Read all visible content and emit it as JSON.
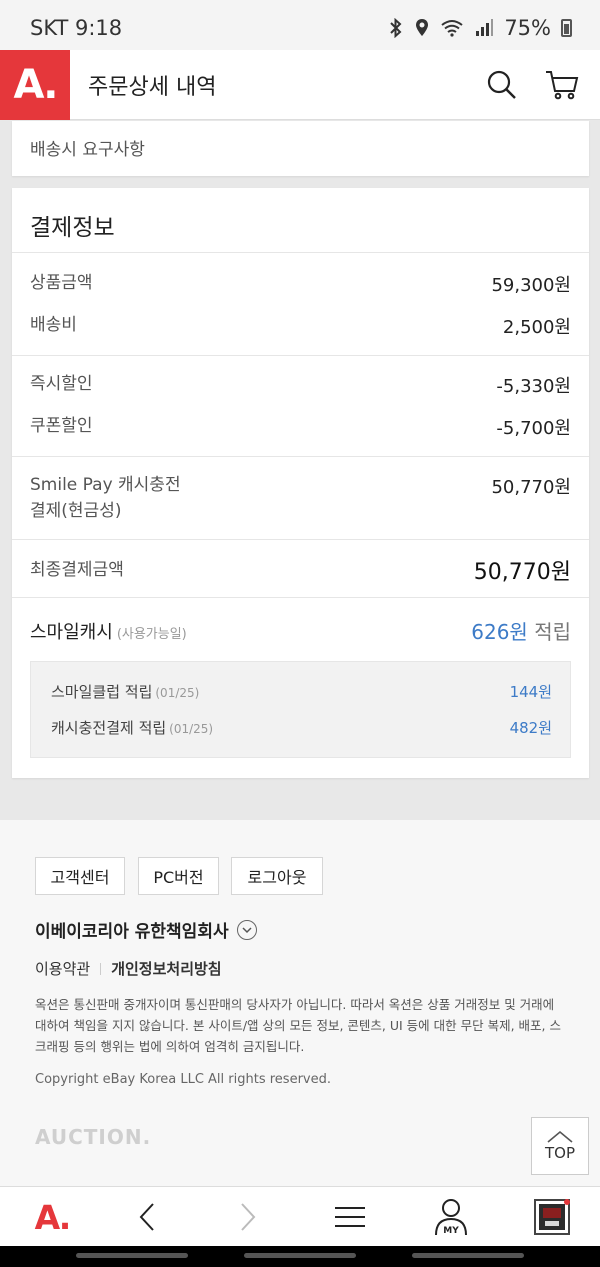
{
  "status_bar": {
    "carrier_time": "SKT 9:18",
    "battery": "75%"
  },
  "header": {
    "logo": "A.",
    "title": "주문상세 내역"
  },
  "delivery": {
    "request_label": "배송시 요구사항"
  },
  "payment": {
    "title": "결제정보",
    "rows": [
      {
        "label": "상품금액",
        "value": "59,300원"
      },
      {
        "label": "배송비",
        "value": "2,500원"
      },
      {
        "label": "즉시할인",
        "value": "-5,330원"
      },
      {
        "label": "쿠폰할인",
        "value": "-5,700원"
      },
      {
        "label_line1": "Smile Pay 캐시충전",
        "label_line2": "결제(현금성)",
        "value": "50,770원"
      }
    ],
    "final": {
      "label": "최종결제금액",
      "value": "50,770원"
    },
    "smile_cash": {
      "label": "스마일캐시",
      "sub": "(사용가능일)",
      "amount": "626원",
      "suffix": "적립"
    },
    "details": [
      {
        "label": "스마일클럽 적립",
        "date": "(01/25)",
        "value": "144원"
      },
      {
        "label": "캐시충전결제 적립",
        "date": "(01/25)",
        "value": "482원"
      }
    ]
  },
  "footer": {
    "buttons": [
      "고객센터",
      "PC버전",
      "로그아웃"
    ],
    "company": "이베이코리아 유한책임회사",
    "policy_links": [
      "이용약관",
      "개인정보처리방침"
    ],
    "notice": "옥션은 통신판매 중개자이며 통신판매의 당사자가 아닙니다. 따라서 옥션은 상품 거래정보 및 거래에 대하여 책임을 지지 않습니다. 본 사이트/앱 상의 모든 정보, 콘텐츠, UI 등에 대한 무단 복제, 배포, 스크래핑 등의 행위는 법에 의하여 엄격히 금지됩니다.",
    "copyright": "Copyright eBay Korea LLC All rights reserved.",
    "watermark": "AUCTION.",
    "top_button": "TOP"
  },
  "bottom_nav": {
    "logo": "A.",
    "my_label": "MY"
  },
  "colors": {
    "brand": "#e5373b",
    "accent_blue": "#3d7bc7"
  }
}
